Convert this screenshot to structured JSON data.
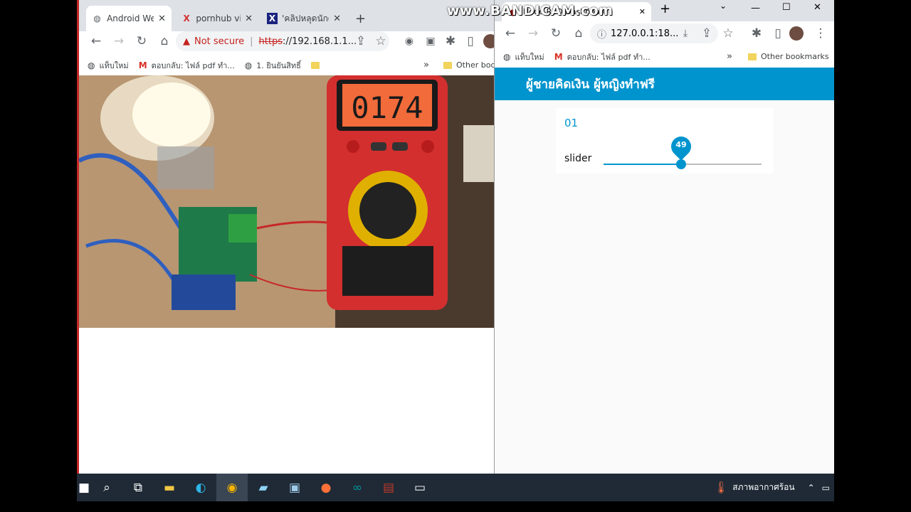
{
  "left_browser": {
    "tabs": [
      {
        "title": "Android We",
        "icon": "globe-icon"
      },
      {
        "title": "pornhub vid",
        "icon": "x-red-icon"
      },
      {
        "title": "'คลิปหลุดนักศึ",
        "icon": "x-blue-icon"
      }
    ],
    "new_tab": "+",
    "security": "Not secure",
    "url_scheme": "https",
    "url_rest": "://192.168.1.1...",
    "bookmarks": [
      {
        "label": "แท็บใหม่",
        "icon": "globe-icon"
      },
      {
        "label": "ตอบกลับ: ไฟล์ pdf ทำ...",
        "icon": "gmail-icon"
      },
      {
        "label": "1. ยินยันสิทธิ์",
        "icon": "globe-icon"
      }
    ],
    "bookmarks_more": "»",
    "other_bookmarks": "Other boo"
  },
  "right_browser": {
    "tab_title": "Node-RED Dashboard",
    "new_tab": "+",
    "url": "127.0.0.1:18...",
    "bookmarks": [
      {
        "label": "แท็บใหม่",
        "icon": "globe-icon"
      },
      {
        "label": "ตอบกลับ: ไฟล์ pdf ทำ...",
        "icon": "gmail-icon"
      }
    ],
    "bookmarks_more": "»",
    "other_bookmarks": "Other bookmarks",
    "dashboard_title": "ผู้ชายคิดเงิน ผู้หญิงทำฟรี",
    "card_title": "01",
    "slider_label": "slider",
    "slider_value": "49",
    "slider_fraction": 0.49
  },
  "window_controls": {
    "minimize": "—",
    "maximize": "☐",
    "close": "✕"
  },
  "watermark": "www.BANDICAM.com",
  "taskbar": {
    "weather": "สภาพอากาศร้อน",
    "apps": [
      "start",
      "search",
      "task-view",
      "file-explorer",
      "edge",
      "chrome",
      "notepad",
      "app",
      "firefox",
      "arduino",
      "winrar",
      "terminal"
    ]
  },
  "colors": {
    "accent": "#0094ce",
    "warning": "#c5221f"
  }
}
